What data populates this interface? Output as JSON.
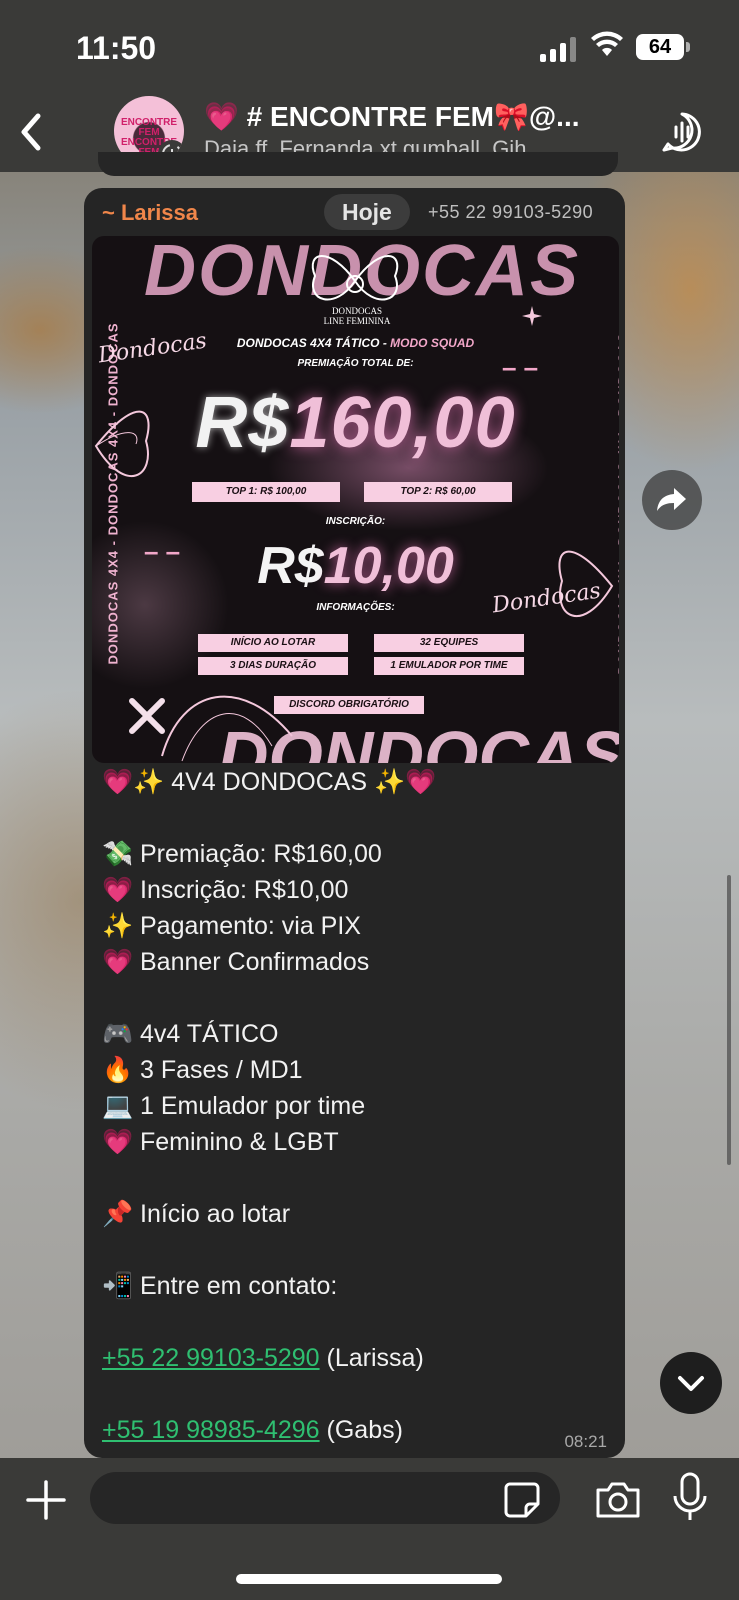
{
  "status_bar": {
    "time": "11:50",
    "battery": "64"
  },
  "header": {
    "title": "💗 # ENCONTRE FEM🎀@...",
    "subtitle": "Daia ff, Fernanda xt gumball, Gih...",
    "avatar_text": "ENCONTRE FEM ENCONTRE FEM"
  },
  "message": {
    "sender_name": "~ Larissa",
    "day_label": "Hoje",
    "sender_phone": "+55 22 99103-5290",
    "time": "08:21",
    "banner": {
      "watermark_top": "DONDOCAS",
      "watermark_bottom": "DONDOCAS",
      "side_text": "DONDOCAS 4X4 - DONDOCAS 4X4 - DONDOCAS",
      "logo_name": "DONDOCAS",
      "logo_sub": "LINE FEMININA",
      "script": "Dondocas",
      "headline_main": "DONDOCAS 4X4 TÁTICO - ",
      "headline_mode": "MODO SQUAD",
      "subline": "PREMIAÇÃO TOTAL DE:",
      "prize_currency": "R$",
      "prize_amount": "160,00",
      "top1": "TOP 1: R$ 100,00",
      "top2": "TOP 2: R$ 60,00",
      "inscricao_label": "INSCRIÇÃO:",
      "fee_currency": "R$",
      "fee_amount": "10,00",
      "info_label": "INFORMAÇÕES:",
      "info_items": [
        "INÍCIO AO LOTAR",
        "3 DIAS DURAÇÃO",
        "32 EQUIPES",
        "1 EMULADOR POR TIME",
        "DISCORD OBRIGATÓRIO"
      ],
      "dash": "– –"
    },
    "lines": {
      "title_left_emoji": "💗✨",
      "title": "4V4 DONDOCAS",
      "title_right_emoji": "✨💗",
      "l1_emoji": "💸",
      "l1": "Premiação: R$160,00",
      "l2_emoji": "💗",
      "l2": "Inscrição: R$10,00",
      "l3_emoji": "✨",
      "l3": "Pagamento: via PIX",
      "l4_emoji": "💗",
      "l4": "Banner Confirmados",
      "l5_emoji": "🎮",
      "l5": "4v4 TÁTICO",
      "l6_emoji": "🔥",
      "l6": "3 Fases / MD1",
      "l7_emoji": "💻",
      "l7": "1 Emulador por time",
      "l8_emoji": "💗",
      "l8": "Feminino & LGBT",
      "l9_emoji": "📌",
      "l9": "Início ao lotar",
      "l10_emoji": "📲",
      "l10": "Entre em contato:",
      "phone1": "+55 22 99103-5290",
      "phone1_name": "(Larissa)",
      "phone2": "+55 19 98985-4296",
      "phone2_name": "(Gabs)"
    }
  },
  "input": {
    "placeholder": ""
  },
  "icons": [
    "back-icon",
    "call-icon",
    "forward-icon",
    "chevron-down-icon",
    "add-icon",
    "sticker-icon",
    "camera-icon",
    "mic-icon"
  ]
}
